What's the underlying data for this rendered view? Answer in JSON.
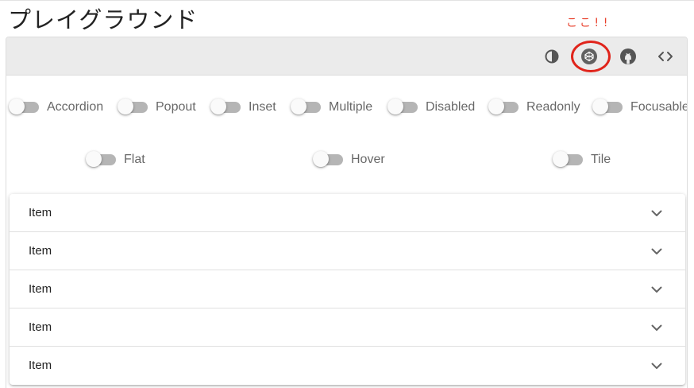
{
  "page": {
    "title": "プレイグラウンド"
  },
  "annotation": {
    "text": "ここ!!",
    "color": "#e8402c"
  },
  "toolbar": {
    "icons": [
      {
        "name": "theme-toggle-icon"
      },
      {
        "name": "codepen-icon",
        "highlighted": true
      },
      {
        "name": "github-icon"
      },
      {
        "name": "code-icon"
      }
    ]
  },
  "switches": {
    "row1": [
      {
        "label": "Accordion",
        "on": false
      },
      {
        "label": "Popout",
        "on": false
      },
      {
        "label": "Inset",
        "on": false
      },
      {
        "label": "Multiple",
        "on": false
      },
      {
        "label": "Disabled",
        "on": false
      },
      {
        "label": "Readonly",
        "on": false
      },
      {
        "label": "Focusable",
        "on": false
      }
    ],
    "row2": [
      {
        "label": "Flat",
        "on": false
      },
      {
        "label": "Hover",
        "on": false
      },
      {
        "label": "Tile",
        "on": false
      }
    ]
  },
  "panels": [
    {
      "title": "Item"
    },
    {
      "title": "Item"
    },
    {
      "title": "Item"
    },
    {
      "title": "Item"
    },
    {
      "title": "Item"
    }
  ],
  "colors": {
    "toolbar_bg": "#ebebeb",
    "highlight": "#e0241b",
    "switch_track": "#b5b5b5"
  }
}
